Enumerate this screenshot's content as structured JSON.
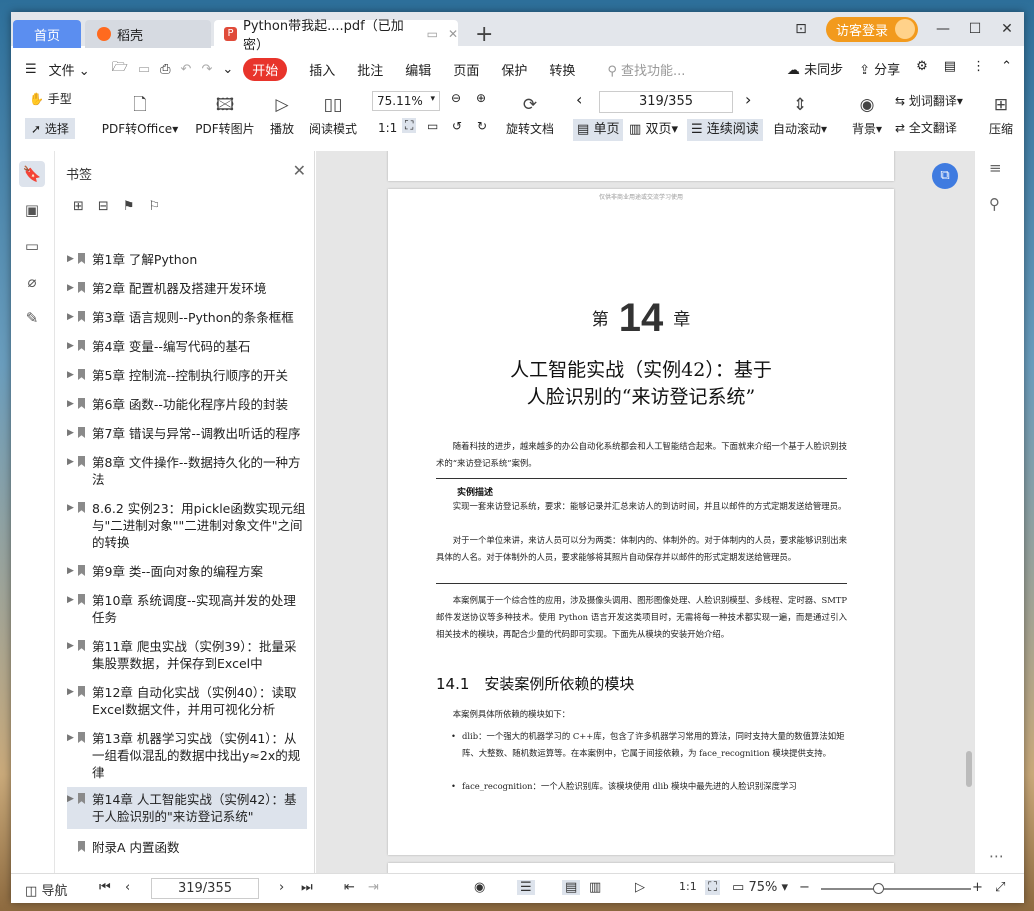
{
  "tabs": {
    "home": "首页",
    "doc": "稻壳",
    "active": "Python带我起....pdf（已加密）"
  },
  "window": {
    "login": "访客登录"
  },
  "menu": {
    "file": "文件",
    "start": "开始",
    "items": [
      "插入",
      "批注",
      "编辑",
      "页面",
      "保护",
      "转换"
    ],
    "search_placeholder": "查找功能...",
    "unsynced": "未同步",
    "share": "分享"
  },
  "toolbar": {
    "hand": "手型",
    "select": "选择",
    "pdf_to_office": "PDF转Office",
    "pdf_to_image": "PDF转图片",
    "play": "播放",
    "read_mode": "阅读模式",
    "zoom": "75.11%",
    "page": "319/355",
    "rotate": "旋转文档",
    "single": "单页",
    "double": "双页",
    "continuous": "连续阅读",
    "autoscroll": "自动滚动",
    "background": "背景",
    "translate_word": "划词翻译",
    "translate_full": "全文翻译",
    "compress": "压缩"
  },
  "panel": {
    "title": "书签",
    "bookmarks": [
      "第1章 了解Python",
      "第2章 配置机器及搭建开发环境",
      "第3章 语言规则--Python的条条框框",
      "第4章 变量--编写代码的基石",
      "第5章 控制流--控制执行顺序的开关",
      "第6章 函数--功能化程序片段的封装",
      "第7章 错误与异常--调教出听话的程序",
      "第8章 文件操作--数据持久化的一种方法",
      "8.6.2 实例23：用pickle函数实现元组与\"二进制对象\"\"二进制对象文件\"之间的转换",
      "第9章 类--面向对象的编程方案",
      "第10章 系统调度--实现高并发的处理任务",
      "第11章 爬虫实战（实例39）：批量采集股票数据，并保存到Excel中",
      "第12章 自动化实战（实例40）：读取Excel数据文件，并用可视化分析",
      "第13章 机器学习实战（实例41）：从一组看似混乱的数据中找出y≈2x的规律",
      "第14章 人工智能实战（实例42）：基于人脸识别的\"来访登记系统\"",
      "附录A 内置函数"
    ]
  },
  "page": {
    "watermark": "仅供非商业用途或交流学习使用",
    "chapter_prefix": "第",
    "chapter_number": "14",
    "chapter_suffix": "章",
    "title_line1": "人工智能实战（实例42）：基于",
    "title_line2": "人脸识别的“来访登记系统”",
    "intro": "随着科技的进步，越来越多的办公自动化系统都会和人工智能结合起来。下面就来介绍一个基于人脸识别技术的“来访登记系统”案例。",
    "box_title": "实例描述",
    "box_p1": "实现一套来访登记系统，要求：能够记录并汇总来访人的到访时间，并且以邮件的方式定期发送给管理员。",
    "box_p2": "对于一个单位来讲，来访人员可以分为两类：体制内的、体制外的。对于体制内的人员，要求能够识别出来具体的人名。对于体制外的人员，要求能够将其照片自动保存并以邮件的形式定期发送给管理员。",
    "body": "本案例属于一个综合性的应用，涉及摄像头调用、图形图像处理、人脸识别模型、多线程、定时器、SMTP 邮件发送协议等多种技术。使用 Python 语言开发这类项目时，无需将每一种技术都实现一遍，而是通过引入相关技术的模块，再配合少量的代码即可实现。下面先从模块的安装开始介绍。",
    "section": "14.1　安装案例所依赖的模块",
    "section_intro": "本案例具体所依赖的模块如下：",
    "bullet1": "dlib：一个强大的机器学习的 C++库，包含了许多机器学习常用的算法，同时支持大量的数值算法如矩阵、大整数、随机数运算等。在本案例中，它属于间接依赖，为 face_recognition 模块提供支持。",
    "bullet2": "face_recognition：一个人脸识别库。该模块使用 dlib 模块中最先进的人脸识别深度学习"
  },
  "status": {
    "nav": "导航",
    "page": "319/355",
    "zoom": "75%"
  }
}
